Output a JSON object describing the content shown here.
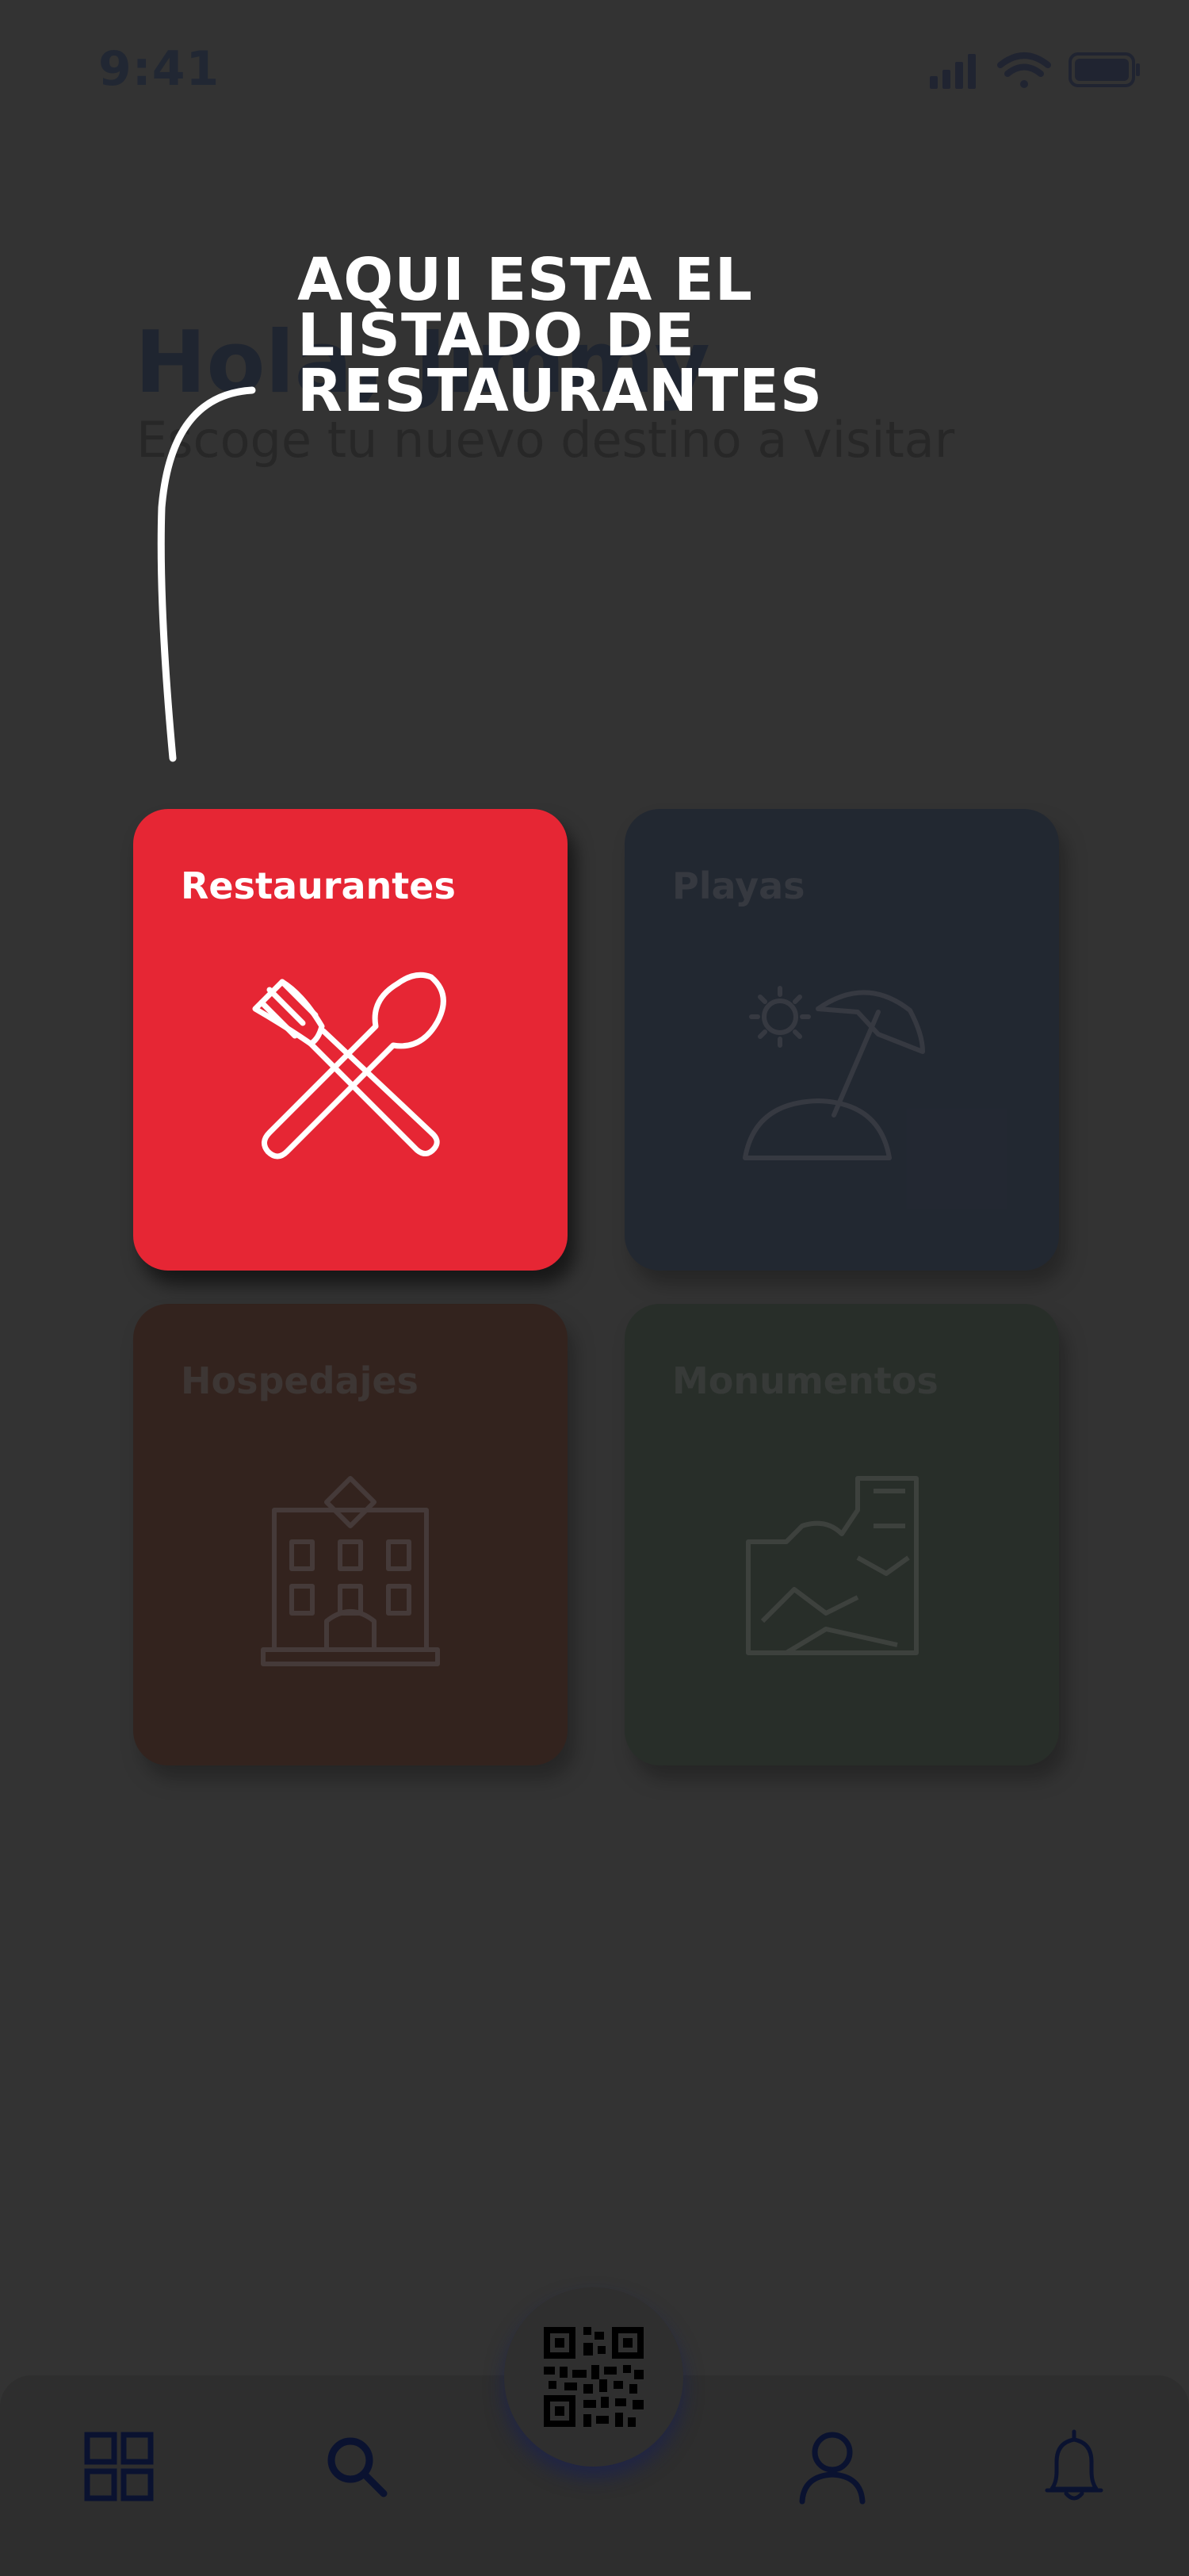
{
  "status_bar": {
    "time": "9:41",
    "icons": [
      "signal-icon",
      "wifi-icon",
      "battery-icon"
    ]
  },
  "header": {
    "greeting": "Hola, Jimmy",
    "subtitle": "Escoge tu nuevo destino a visitar"
  },
  "tooltip": {
    "lines": [
      "AQUI ESTA EL",
      "LISTADO DE",
      "RESTAURANTES"
    ]
  },
  "categories": [
    {
      "label": "Restaurantes",
      "icon": "fork-spoon-icon",
      "color": "#e62634",
      "highlighted": true
    },
    {
      "label": "Playas",
      "icon": "beach-umbrella-icon",
      "color": "#0f1b30",
      "highlighted": false
    },
    {
      "label": "Hospedajes",
      "icon": "hotel-icon",
      "color": "#341106",
      "highlighted": false
    },
    {
      "label": "Monumentos",
      "icon": "monument-icon",
      "color": "#1b281e",
      "highlighted": false
    }
  ],
  "tab_bar": {
    "items": [
      "grid-icon",
      "search-icon",
      "qr-code-icon",
      "profile-icon",
      "bell-icon"
    ]
  },
  "colors": {
    "background": "#333333",
    "accent": "#e62634",
    "nav_icons": "#0a1230"
  }
}
